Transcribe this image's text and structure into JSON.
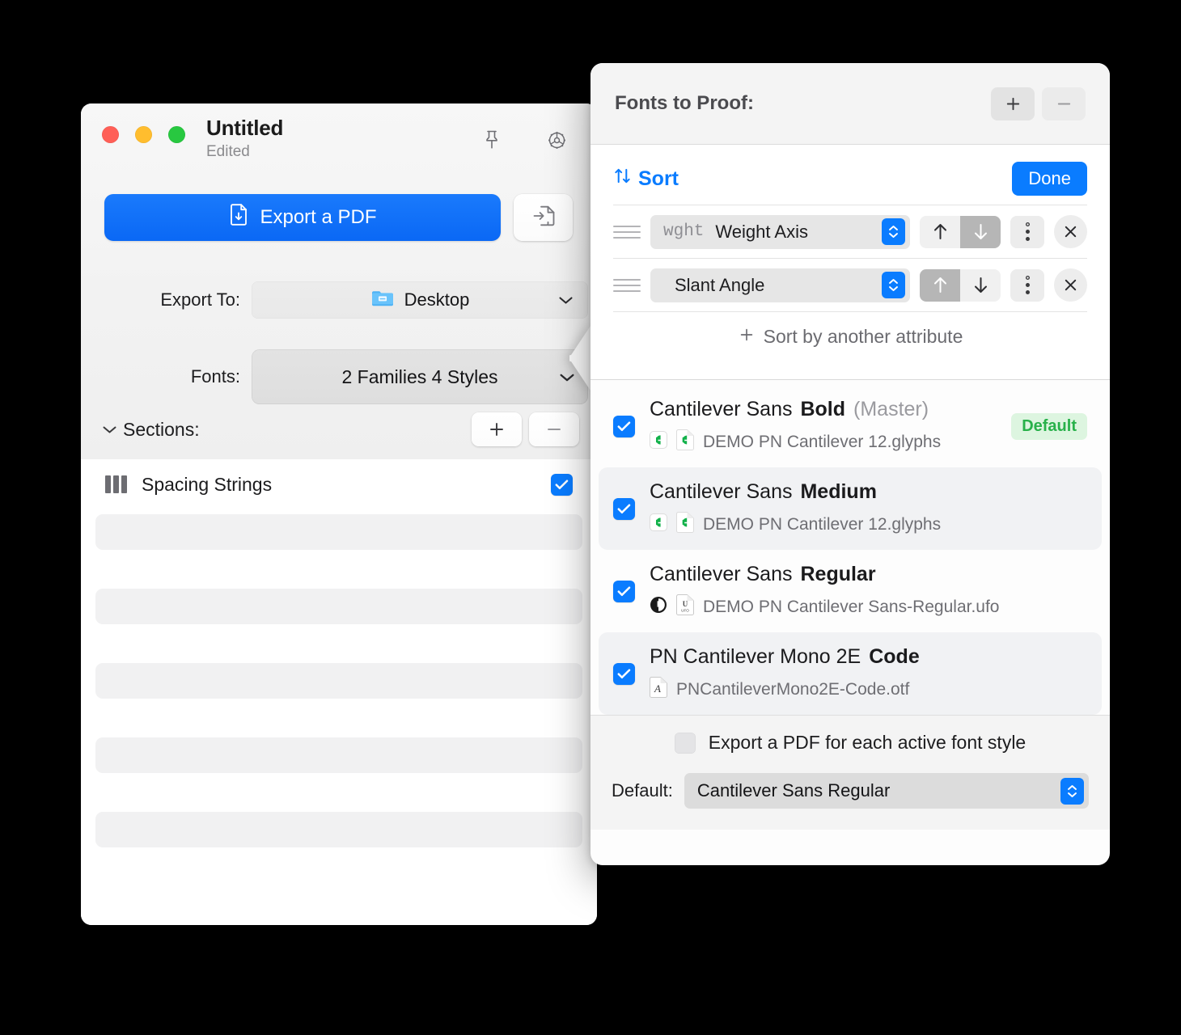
{
  "main_window": {
    "title": "Untitled",
    "subtitle": "Edited",
    "pin_icon": "pin-icon",
    "gear_icon": "gear-icon",
    "export_button_label": "Export a PDF",
    "export_button_icon": "document-download-icon",
    "import_button_icon": "import-document-icon",
    "export_to_label": "Export To:",
    "export_to_value": "Desktop",
    "export_to_icon": "folder-icon",
    "fonts_label": "Fonts:",
    "fonts_value": "2 Families 4 Styles",
    "sections_label": "Sections:",
    "sections_add": "+",
    "sections_remove": "−",
    "spacing_row_label": "Spacing Strings",
    "spacing_row_icon": "columns-icon",
    "spacing_row_checked": true,
    "placeholder_bar_count": 5
  },
  "popover": {
    "title": "Fonts to Proof:",
    "add_label": "+",
    "remove_label": "−",
    "sort": {
      "link_label": "Sort",
      "sort_icon": "sort-arrows-icon",
      "done_label": "Done",
      "add_attribute_label": "Sort by another attribute",
      "rows": [
        {
          "tag": "wght",
          "name": "Weight Axis",
          "direction": "descending"
        },
        {
          "tag": "",
          "name": "Slant Angle",
          "direction": "ascending"
        }
      ]
    },
    "fonts": [
      {
        "family": "Cantilever Sans",
        "style": "Bold",
        "master": "(Master)",
        "file": "DEMO PN Cantilever 12.glyphs",
        "file_icons": [
          "glyphs-app-icon",
          "glyphs-file-icon"
        ],
        "checked": true,
        "badge": "Default",
        "alt_row": false
      },
      {
        "family": "Cantilever Sans",
        "style": "Medium",
        "master": "",
        "file": "DEMO PN Cantilever 12.glyphs",
        "file_icons": [
          "glyphs-app-icon",
          "glyphs-file-icon"
        ],
        "checked": true,
        "badge": "",
        "alt_row": true
      },
      {
        "family": "Cantilever Sans",
        "style": "Regular",
        "master": "",
        "file": "DEMO PN Cantilever Sans-Regular.ufo",
        "file_icons": [
          "robofont-app-icon",
          "ufo-file-icon"
        ],
        "checked": true,
        "badge": "",
        "alt_row": false
      },
      {
        "family": "PN Cantilever Mono 2E",
        "style": "Code",
        "master": "",
        "file": "PNCantileverMono2E-Code.otf",
        "file_icons": [
          "otf-file-icon"
        ],
        "checked": true,
        "badge": "",
        "alt_row": true
      }
    ],
    "footer": {
      "each_style_label": "Export a PDF for each active font style",
      "each_style_checked": false,
      "default_label": "Default:",
      "default_value": "Cantilever Sans Regular"
    }
  },
  "colors": {
    "accent_blue": "#0a7cff",
    "badge_green_bg": "#ddf5e0",
    "badge_green_text": "#28b14a",
    "traffic_red": "#ff5f57",
    "traffic_yellow": "#ffbd2e",
    "traffic_green": "#28c840"
  }
}
